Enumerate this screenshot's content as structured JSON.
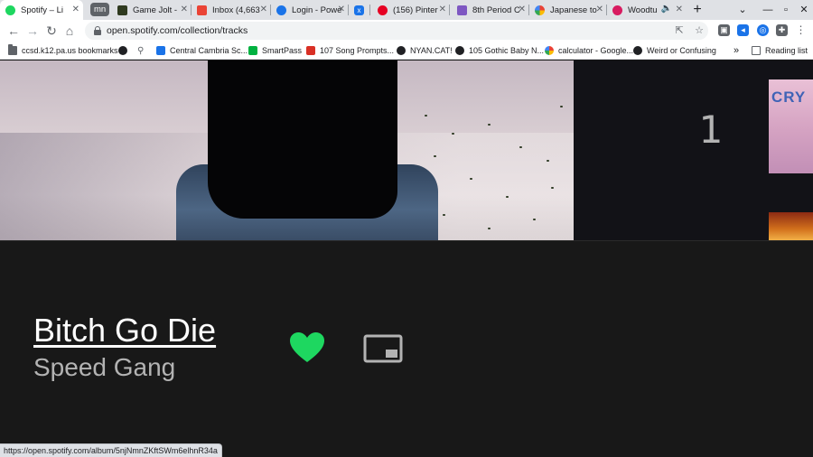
{
  "browser": {
    "tabs": [
      {
        "label": "Spotify – Li",
        "icon": "spotify-icon",
        "color": "#1ed760",
        "active": true
      },
      {
        "label": "mn",
        "group": true
      },
      {
        "label": "Game Jolt -",
        "icon": "gamejolt-icon",
        "color": "#2f3a1f"
      },
      {
        "label": "Inbox (4,663",
        "icon": "gmail-icon",
        "color": "#ea4335"
      },
      {
        "label": "Login - Powe",
        "icon": "powerschool-icon",
        "color": "#1a73e8"
      },
      {
        "label": "x",
        "icon": "x-icon",
        "color": "#1a73e8"
      },
      {
        "label": "(156) Pinter",
        "icon": "pinterest-icon",
        "color": "#e60023"
      },
      {
        "label": "8th Period C",
        "icon": "classroom-icon",
        "color": "#7e57c2"
      },
      {
        "label": "Japanese to",
        "icon": "google-icon",
        "color": "#4285f4"
      },
      {
        "label": "Woodtu",
        "icon": "woodtu-icon",
        "color": "#d81b60"
      }
    ],
    "new_tab": "+",
    "url": "open.spotify.com/collection/tracks",
    "bookmarks": [
      {
        "label": "ccsd.k12.pa.us bookmarks",
        "icon": "folder-icon"
      },
      {
        "label": "",
        "icon": "globe-icon"
      },
      {
        "label": "",
        "icon": "search-icon"
      },
      {
        "label": "Central Cambria Sc...",
        "icon": "school-icon"
      },
      {
        "label": "SmartPass",
        "icon": "smartpass-icon"
      },
      {
        "label": "107 Song Prompts...",
        "icon": "prompts-icon"
      },
      {
        "label": "NYAN.CAT!",
        "icon": "globe-icon"
      },
      {
        "label": "105 Gothic Baby N...",
        "icon": "gothic-icon"
      },
      {
        "label": "calculator - Google...",
        "icon": "google-icon"
      },
      {
        "label": "Weird or Confusing",
        "icon": "globe-icon"
      }
    ],
    "more": "»",
    "reading_list": "Reading list",
    "status_url": "https://open.spotify.com/album/5njNmnZKftSWm6elhnR34a"
  },
  "player": {
    "title": "Bitch Go Die",
    "artist": "Speed Gang",
    "liked": true,
    "queue_number": "1",
    "thumb_text": "CRY",
    "accent": "#1ed760"
  }
}
